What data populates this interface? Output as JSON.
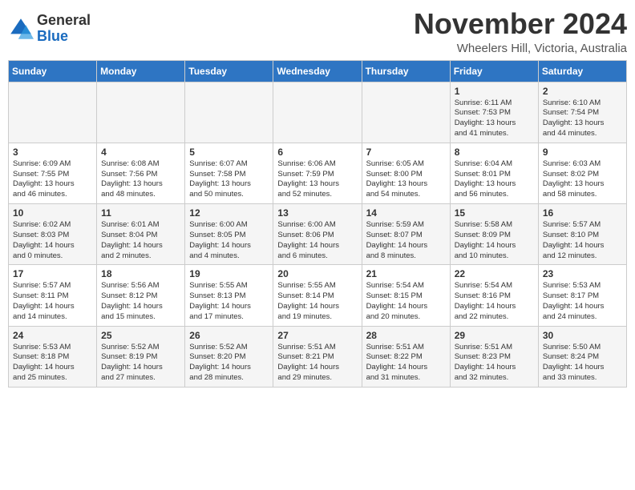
{
  "header": {
    "logo_line1": "General",
    "logo_line2": "Blue",
    "month": "November 2024",
    "location": "Wheelers Hill, Victoria, Australia"
  },
  "weekdays": [
    "Sunday",
    "Monday",
    "Tuesday",
    "Wednesday",
    "Thursday",
    "Friday",
    "Saturday"
  ],
  "weeks": [
    [
      {
        "day": "",
        "info": ""
      },
      {
        "day": "",
        "info": ""
      },
      {
        "day": "",
        "info": ""
      },
      {
        "day": "",
        "info": ""
      },
      {
        "day": "",
        "info": ""
      },
      {
        "day": "1",
        "info": "Sunrise: 6:11 AM\nSunset: 7:53 PM\nDaylight: 13 hours\nand 41 minutes."
      },
      {
        "day": "2",
        "info": "Sunrise: 6:10 AM\nSunset: 7:54 PM\nDaylight: 13 hours\nand 44 minutes."
      }
    ],
    [
      {
        "day": "3",
        "info": "Sunrise: 6:09 AM\nSunset: 7:55 PM\nDaylight: 13 hours\nand 46 minutes."
      },
      {
        "day": "4",
        "info": "Sunrise: 6:08 AM\nSunset: 7:56 PM\nDaylight: 13 hours\nand 48 minutes."
      },
      {
        "day": "5",
        "info": "Sunrise: 6:07 AM\nSunset: 7:58 PM\nDaylight: 13 hours\nand 50 minutes."
      },
      {
        "day": "6",
        "info": "Sunrise: 6:06 AM\nSunset: 7:59 PM\nDaylight: 13 hours\nand 52 minutes."
      },
      {
        "day": "7",
        "info": "Sunrise: 6:05 AM\nSunset: 8:00 PM\nDaylight: 13 hours\nand 54 minutes."
      },
      {
        "day": "8",
        "info": "Sunrise: 6:04 AM\nSunset: 8:01 PM\nDaylight: 13 hours\nand 56 minutes."
      },
      {
        "day": "9",
        "info": "Sunrise: 6:03 AM\nSunset: 8:02 PM\nDaylight: 13 hours\nand 58 minutes."
      }
    ],
    [
      {
        "day": "10",
        "info": "Sunrise: 6:02 AM\nSunset: 8:03 PM\nDaylight: 14 hours\nand 0 minutes."
      },
      {
        "day": "11",
        "info": "Sunrise: 6:01 AM\nSunset: 8:04 PM\nDaylight: 14 hours\nand 2 minutes."
      },
      {
        "day": "12",
        "info": "Sunrise: 6:00 AM\nSunset: 8:05 PM\nDaylight: 14 hours\nand 4 minutes."
      },
      {
        "day": "13",
        "info": "Sunrise: 6:00 AM\nSunset: 8:06 PM\nDaylight: 14 hours\nand 6 minutes."
      },
      {
        "day": "14",
        "info": "Sunrise: 5:59 AM\nSunset: 8:07 PM\nDaylight: 14 hours\nand 8 minutes."
      },
      {
        "day": "15",
        "info": "Sunrise: 5:58 AM\nSunset: 8:09 PM\nDaylight: 14 hours\nand 10 minutes."
      },
      {
        "day": "16",
        "info": "Sunrise: 5:57 AM\nSunset: 8:10 PM\nDaylight: 14 hours\nand 12 minutes."
      }
    ],
    [
      {
        "day": "17",
        "info": "Sunrise: 5:57 AM\nSunset: 8:11 PM\nDaylight: 14 hours\nand 14 minutes."
      },
      {
        "day": "18",
        "info": "Sunrise: 5:56 AM\nSunset: 8:12 PM\nDaylight: 14 hours\nand 15 minutes."
      },
      {
        "day": "19",
        "info": "Sunrise: 5:55 AM\nSunset: 8:13 PM\nDaylight: 14 hours\nand 17 minutes."
      },
      {
        "day": "20",
        "info": "Sunrise: 5:55 AM\nSunset: 8:14 PM\nDaylight: 14 hours\nand 19 minutes."
      },
      {
        "day": "21",
        "info": "Sunrise: 5:54 AM\nSunset: 8:15 PM\nDaylight: 14 hours\nand 20 minutes."
      },
      {
        "day": "22",
        "info": "Sunrise: 5:54 AM\nSunset: 8:16 PM\nDaylight: 14 hours\nand 22 minutes."
      },
      {
        "day": "23",
        "info": "Sunrise: 5:53 AM\nSunset: 8:17 PM\nDaylight: 14 hours\nand 24 minutes."
      }
    ],
    [
      {
        "day": "24",
        "info": "Sunrise: 5:53 AM\nSunset: 8:18 PM\nDaylight: 14 hours\nand 25 minutes."
      },
      {
        "day": "25",
        "info": "Sunrise: 5:52 AM\nSunset: 8:19 PM\nDaylight: 14 hours\nand 27 minutes."
      },
      {
        "day": "26",
        "info": "Sunrise: 5:52 AM\nSunset: 8:20 PM\nDaylight: 14 hours\nand 28 minutes."
      },
      {
        "day": "27",
        "info": "Sunrise: 5:51 AM\nSunset: 8:21 PM\nDaylight: 14 hours\nand 29 minutes."
      },
      {
        "day": "28",
        "info": "Sunrise: 5:51 AM\nSunset: 8:22 PM\nDaylight: 14 hours\nand 31 minutes."
      },
      {
        "day": "29",
        "info": "Sunrise: 5:51 AM\nSunset: 8:23 PM\nDaylight: 14 hours\nand 32 minutes."
      },
      {
        "day": "30",
        "info": "Sunrise: 5:50 AM\nSunset: 8:24 PM\nDaylight: 14 hours\nand 33 minutes."
      }
    ]
  ]
}
